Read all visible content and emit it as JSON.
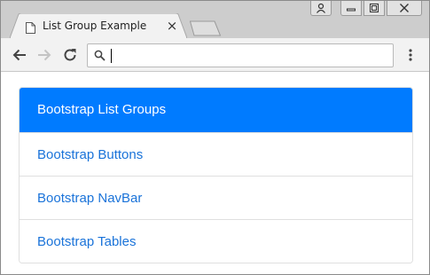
{
  "browser": {
    "tab": {
      "title": "List Group Example",
      "close_glyph": "×",
      "favicon": "page-icon"
    },
    "address_bar": {
      "value": "",
      "placeholder": "",
      "icon": "search-icon"
    },
    "nav": {
      "back_icon": "back-arrow-icon",
      "forward_icon": "forward-arrow-icon",
      "reload_icon": "reload-icon",
      "menu_icon": "menu-dots-icon"
    },
    "window_controls": [
      "user-icon",
      "minimize-icon",
      "maximize-icon",
      "close-icon"
    ]
  },
  "list_group": {
    "items": [
      {
        "label": "Bootstrap List Groups",
        "active": true
      },
      {
        "label": "Bootstrap Buttons",
        "active": false
      },
      {
        "label": "Bootstrap NavBar",
        "active": false
      },
      {
        "label": "Bootstrap Tables",
        "active": false
      }
    ]
  },
  "colors": {
    "active_bg": "#007bff",
    "link": "#1a73d9",
    "tabstrip": "#cdcdcd",
    "toolbar": "#f2f2f2"
  }
}
